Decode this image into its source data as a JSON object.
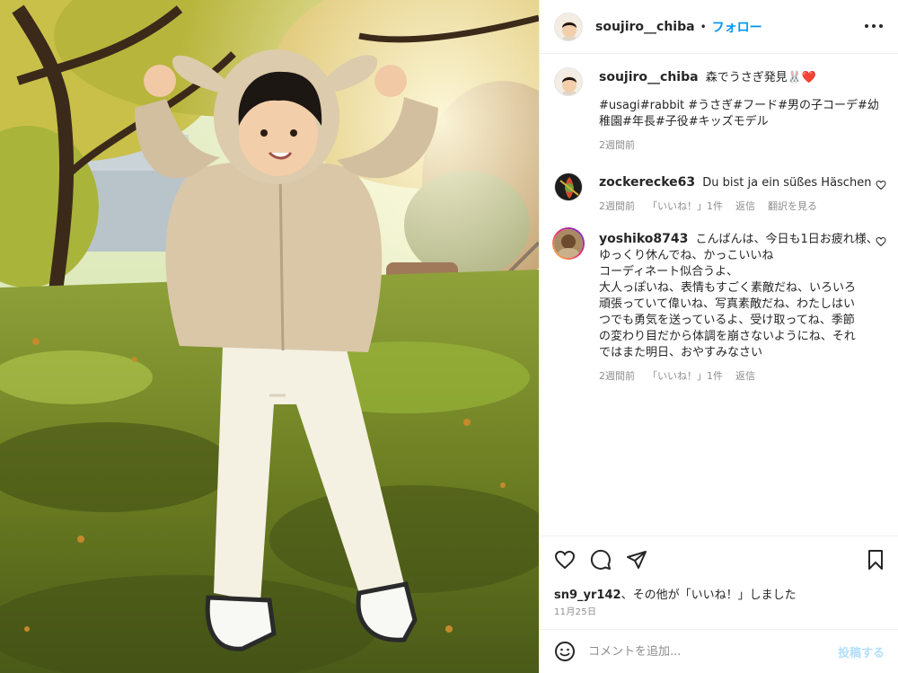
{
  "post": {
    "username": "soujiro__chiba",
    "separator": "•",
    "follow_label": "フォロー",
    "photo_alt": "boy in bunny hoodie"
  },
  "caption": {
    "username": "soujiro__chiba",
    "text": "森でうさぎ発見🐰❤️",
    "hashtags_line1": "#usagi#rabbit #うさぎ#フード#男の子コーデ#幼",
    "hashtags_line2": "稚園#年長#子役#キッズモデル",
    "time": "2週間前"
  },
  "comments": [
    {
      "username": "zockerecke63",
      "text": "Du bist ja ein süßes Häschen",
      "time": "2週間前",
      "likes": "「いいね！」1件",
      "reply": "返信",
      "translate": "翻訳を見る"
    },
    {
      "username": "yoshiko8743",
      "lines": [
        "こんばんは、今日も1日お疲れ様、",
        "ゆっくり休んでね、かっこいいね",
        "コーディネート似合うよ、",
        "大人っぽいね、表情もすごく素敵だね、いろいろ",
        "頑張っていて偉いね、写真素敵だね、わたしはい",
        "つでも勇気を送っているよ、受け取ってね、季節",
        "の変わり目だから体調を崩さないようにね、それ",
        "ではまた明日、おやすみなさい"
      ],
      "time": "2週間前",
      "likes": "「いいね！」1件",
      "reply": "返信"
    }
  ],
  "likes_line": {
    "user": "sn9_yr142",
    "suffix": "、その他が「いいね！」しました"
  },
  "date": "11月25日",
  "comment_input": {
    "placeholder": "コメントを追加...",
    "post_label": "投稿する"
  },
  "icons": {
    "more": "more-options-icon",
    "like": "heart-icon",
    "comment": "comment-icon",
    "share": "share-icon",
    "save": "bookmark-icon",
    "emoji": "emoji-icon"
  },
  "colors": {
    "accent": "#0095f6",
    "text": "#262626",
    "muted": "#8e8e8e",
    "hashtag": "#00376b",
    "post_disabled": "#b2dffc"
  }
}
